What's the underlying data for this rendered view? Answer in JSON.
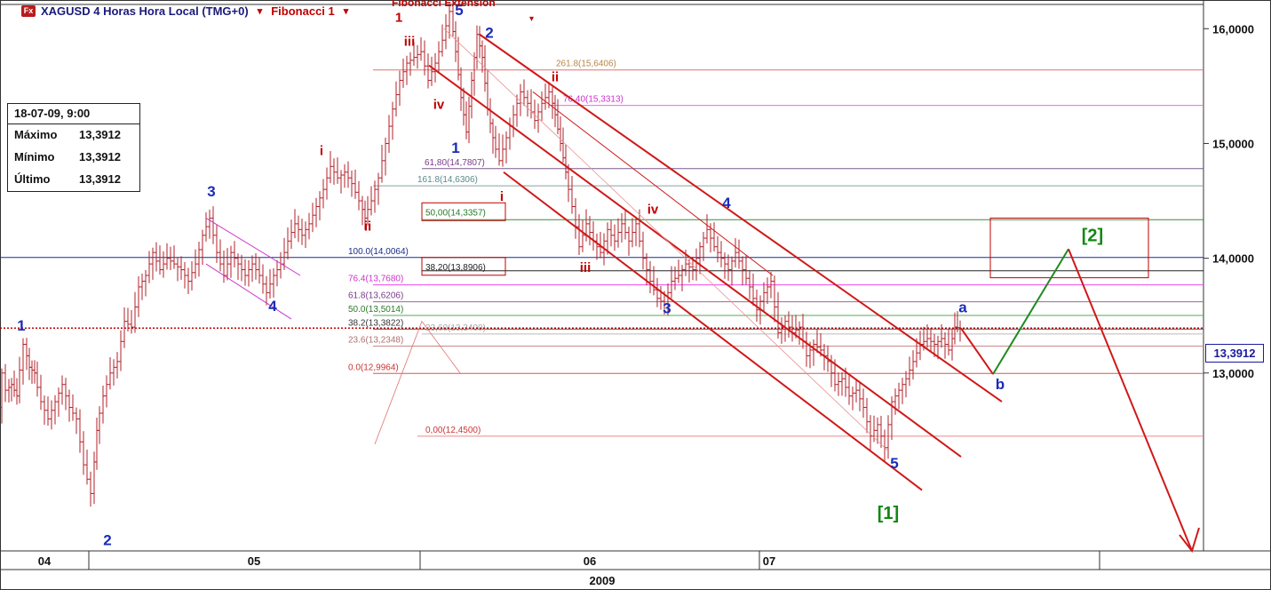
{
  "title": {
    "logo": "Fx",
    "symbol_text": "XAGUSD 4 Horas Hora Local (TMG+0)",
    "fib1_label": "Fibonacci 1",
    "fib_ext_label": "Fibonacci Extension",
    "caret": "▾"
  },
  "info_box": {
    "date": "18-07-09, 9:00",
    "rows": [
      {
        "label": "Máximo",
        "value": "13,3912"
      },
      {
        "label": "Mínimo",
        "value": "13,3912"
      },
      {
        "label": "Último",
        "value": "13,3912"
      }
    ]
  },
  "current_price_tag": "13,3912",
  "colors": {
    "candle": "#b0202a",
    "wave_blue": "#1a2bb8",
    "wave_red": "#c00000",
    "wave_green": "#118811",
    "channel": "#d01818",
    "purple": "#cc33cc",
    "projection_green": "#1f8a1f",
    "projection_red": "#d01818"
  },
  "chart_data": {
    "type": "candlestick",
    "title": "XAGUSD 4 Horas Hora Local (TMG+0)",
    "xlabel": "2009",
    "x_tick_labels": [
      "04",
      "05",
      "06",
      "07"
    ],
    "y_tick_labels": [
      "16,0000",
      "15,0000",
      "14,0000",
      "13,0000"
    ],
    "y_ticks": [
      16.0,
      15.0,
      14.0,
      13.0
    ],
    "ylim": [
      11.45,
      16.25
    ],
    "current_price": 13.3912,
    "price_path": [
      [
        0,
        12.7
      ],
      [
        4,
        13.0
      ],
      [
        8,
        12.85
      ],
      [
        14,
        12.9
      ],
      [
        20,
        12.8
      ],
      [
        28,
        13.25
      ],
      [
        34,
        13.05
      ],
      [
        40,
        13.0
      ],
      [
        48,
        12.75
      ],
      [
        56,
        12.6
      ],
      [
        64,
        12.75
      ],
      [
        72,
        12.9
      ],
      [
        80,
        12.7
      ],
      [
        88,
        12.6
      ],
      [
        96,
        12.2
      ],
      [
        104,
        11.95
      ],
      [
        110,
        12.5
      ],
      [
        118,
        12.8
      ],
      [
        126,
        13.0
      ],
      [
        134,
        13.1
      ],
      [
        142,
        13.45
      ],
      [
        150,
        13.4
      ],
      [
        158,
        13.75
      ],
      [
        166,
        13.85
      ],
      [
        174,
        14.05
      ],
      [
        182,
        13.9
      ],
      [
        190,
        14.0
      ],
      [
        198,
        13.95
      ],
      [
        206,
        13.9
      ],
      [
        214,
        13.8
      ],
      [
        222,
        13.95
      ],
      [
        230,
        14.2
      ],
      [
        238,
        14.35
      ],
      [
        246,
        14.05
      ],
      [
        254,
        13.85
      ],
      [
        262,
        14.05
      ],
      [
        270,
        13.95
      ],
      [
        278,
        13.85
      ],
      [
        286,
        13.95
      ],
      [
        294,
        13.85
      ],
      [
        302,
        13.7
      ],
      [
        310,
        13.85
      ],
      [
        318,
        13.95
      ],
      [
        326,
        14.15
      ],
      [
        334,
        14.3
      ],
      [
        342,
        14.2
      ],
      [
        350,
        14.3
      ],
      [
        358,
        14.45
      ],
      [
        366,
        14.6
      ],
      [
        374,
        14.8
      ],
      [
        382,
        14.7
      ],
      [
        390,
        14.75
      ],
      [
        398,
        14.65
      ],
      [
        406,
        14.5
      ],
      [
        412,
        14.35
      ],
      [
        420,
        14.5
      ],
      [
        428,
        14.7
      ],
      [
        436,
        15.0
      ],
      [
        444,
        15.3
      ],
      [
        452,
        15.55
      ],
      [
        460,
        15.7
      ],
      [
        468,
        15.75
      ],
      [
        476,
        15.8
      ],
      [
        484,
        15.55
      ],
      [
        492,
        15.7
      ],
      [
        500,
        15.9
      ],
      [
        508,
        16.15
      ],
      [
        514,
        15.8
      ],
      [
        520,
        15.4
      ],
      [
        526,
        15.1
      ],
      [
        532,
        15.55
      ],
      [
        538,
        15.95
      ],
      [
        544,
        15.75
      ],
      [
        550,
        15.3
      ],
      [
        556,
        15.05
      ],
      [
        564,
        14.85
      ],
      [
        572,
        15.05
      ],
      [
        580,
        15.25
      ],
      [
        588,
        15.45
      ],
      [
        596,
        15.35
      ],
      [
        604,
        15.2
      ],
      [
        612,
        15.35
      ],
      [
        620,
        15.45
      ],
      [
        626,
        15.25
      ],
      [
        632,
        15.0
      ],
      [
        638,
        14.75
      ],
      [
        646,
        14.45
      ],
      [
        654,
        14.1
      ],
      [
        662,
        14.3
      ],
      [
        670,
        14.15
      ],
      [
        678,
        14.05
      ],
      [
        686,
        14.25
      ],
      [
        694,
        14.15
      ],
      [
        702,
        14.3
      ],
      [
        710,
        14.15
      ],
      [
        718,
        14.3
      ],
      [
        726,
        14.0
      ],
      [
        734,
        13.8
      ],
      [
        742,
        13.65
      ],
      [
        750,
        13.6
      ],
      [
        758,
        13.8
      ],
      [
        766,
        13.85
      ],
      [
        774,
        13.95
      ],
      [
        782,
        13.9
      ],
      [
        790,
        14.1
      ],
      [
        798,
        14.25
      ],
      [
        806,
        14.1
      ],
      [
        814,
        14.0
      ],
      [
        822,
        13.9
      ],
      [
        830,
        14.05
      ],
      [
        838,
        13.9
      ],
      [
        846,
        13.75
      ],
      [
        854,
        13.55
      ],
      [
        862,
        13.7
      ],
      [
        870,
        13.8
      ],
      [
        878,
        13.35
      ],
      [
        886,
        13.45
      ],
      [
        894,
        13.35
      ],
      [
        902,
        13.4
      ],
      [
        910,
        13.15
      ],
      [
        918,
        13.25
      ],
      [
        926,
        13.2
      ],
      [
        934,
        13.1
      ],
      [
        942,
        12.9
      ],
      [
        950,
        12.95
      ],
      [
        958,
        12.8
      ],
      [
        966,
        12.85
      ],
      [
        974,
        12.7
      ],
      [
        982,
        12.45
      ],
      [
        990,
        12.55
      ],
      [
        998,
        12.35
      ],
      [
        1006,
        12.75
      ],
      [
        1014,
        12.85
      ],
      [
        1022,
        12.95
      ],
      [
        1030,
        13.1
      ],
      [
        1038,
        13.25
      ],
      [
        1046,
        13.3
      ],
      [
        1054,
        13.25
      ],
      [
        1062,
        13.3
      ],
      [
        1070,
        13.2
      ],
      [
        1076,
        13.4
      ],
      [
        1082,
        13.39
      ]
    ],
    "horizontal_levels": [
      {
        "label": "261.8(15,6406)",
        "value": 15.6406,
        "color": "#e07070",
        "text_color": "#b8864a"
      },
      {
        "label": "76,40(15,3313)",
        "value": 15.3313,
        "color": "#ee66ee",
        "text_color": "#cc33cc"
      },
      {
        "label": "61,80(14,7807)",
        "value": 14.7807,
        "color": "#7a5a8a",
        "text_color": "#7a3a8a"
      },
      {
        "label": "161.8(14,6306)",
        "value": 14.6306,
        "color": "#8aa0a0",
        "text_color": "#5a8a8a"
      },
      {
        "label": "50,00(14,3357)",
        "value": 14.3357,
        "color": "#3a8a3a",
        "text_color": "#2a7a2a"
      },
      {
        "label": "100.0(14,0064)",
        "value": 14.0064,
        "color": "#1a2b8a",
        "text_color": "#1a2b8a"
      },
      {
        "label": "38,20(13,8906)",
        "value": 13.8906,
        "color": "#222222",
        "text_color": "#222222"
      },
      {
        "label": "76.4(13,7680)",
        "value": 13.768,
        "color": "#ee44ee",
        "text_color": "#cc33cc"
      },
      {
        "label": "61.8(13,6206)",
        "value": 13.6206,
        "color": "#9a6a9a",
        "text_color": "#7a3a8a"
      },
      {
        "label": "50.0(13,5014)",
        "value": 13.5014,
        "color": "#55aa55",
        "text_color": "#2a7a2a"
      },
      {
        "label": "38.2(13,3822)",
        "value": 13.3822,
        "color": "#555555",
        "text_color": "#333333"
      },
      {
        "label": "23,60(13,3400)",
        "value": 13.34,
        "color": "#bbbbbb",
        "text_color": "#a8a8a8"
      },
      {
        "label": "23.6(13,2348)",
        "value": 13.2348,
        "color": "#cc8888",
        "text_color": "#b07070"
      },
      {
        "label": "0.0(12,9964)",
        "value": 12.9964,
        "color": "#dd5555",
        "text_color": "#cc3333"
      },
      {
        "label": "0,00(12,4500)",
        "value": 12.45,
        "color": "#ee8888",
        "text_color": "#cc3333"
      }
    ],
    "boxed_levels": [
      "50,00(14,3357)",
      "38,20(13,8906)"
    ],
    "wave_labels": [
      {
        "text": "1",
        "x": 24,
        "y": 13.37,
        "color": "blue"
      },
      {
        "text": "2",
        "x": 121,
        "y": 11.5,
        "color": "blue"
      },
      {
        "text": "3",
        "x": 238,
        "y": 14.54,
        "color": "blue"
      },
      {
        "text": "4",
        "x": 307,
        "y": 13.54,
        "color": "blue"
      },
      {
        "text": "i",
        "x": 362,
        "y": 14.9,
        "color": "red"
      },
      {
        "text": "ii",
        "x": 414,
        "y": 14.24,
        "color": "red"
      },
      {
        "text": "iii",
        "x": 461,
        "y": 15.85,
        "color": "red"
      },
      {
        "text": "1",
        "x": 449,
        "y": 16.06,
        "color": "red"
      },
      {
        "text": "iv",
        "x": 494,
        "y": 15.3,
        "color": "red"
      },
      {
        "text": "5",
        "x": 517,
        "y": 16.12,
        "color": "blue"
      },
      {
        "text": "2",
        "x": 551,
        "y": 15.92,
        "color": "blue"
      },
      {
        "text": "1",
        "x": 513,
        "y": 14.92,
        "color": "blue"
      },
      {
        "text": "ii",
        "x": 625,
        "y": 15.54,
        "color": "red"
      },
      {
        "text": "i",
        "x": 565,
        "y": 14.5,
        "color": "red"
      },
      {
        "text": "iii",
        "x": 659,
        "y": 13.88,
        "color": "red"
      },
      {
        "text": "iv",
        "x": 735,
        "y": 14.39,
        "color": "red"
      },
      {
        "text": "4",
        "x": 818,
        "y": 14.44,
        "color": "blue"
      },
      {
        "text": "3",
        "x": 751,
        "y": 13.52,
        "color": "blue"
      },
      {
        "text": "5",
        "x": 1007,
        "y": 12.17,
        "color": "blue"
      },
      {
        "text": "[1]",
        "x": 1000,
        "y": 11.73,
        "color": "green"
      },
      {
        "text": "a",
        "x": 1084,
        "y": 13.53,
        "color": "blue"
      },
      {
        "text": "b",
        "x": 1126,
        "y": 12.86,
        "color": "blue"
      },
      {
        "text": "[2]",
        "x": 1230,
        "y": 14.15,
        "color": "green"
      }
    ],
    "projection": [
      {
        "x": 1082,
        "y": 13.39,
        "segment": "red"
      },
      {
        "x": 1118,
        "y": 12.99,
        "segment": "green"
      },
      {
        "x": 1203,
        "y": 14.08,
        "segment": "red"
      },
      {
        "x": 1342,
        "y": 11.45,
        "segment": "red"
      }
    ],
    "target_box": {
      "x_from": 1115,
      "x_to": 1293,
      "y_from": 14.35,
      "y_to": 13.83
    },
    "grid": false,
    "legend": "none"
  }
}
